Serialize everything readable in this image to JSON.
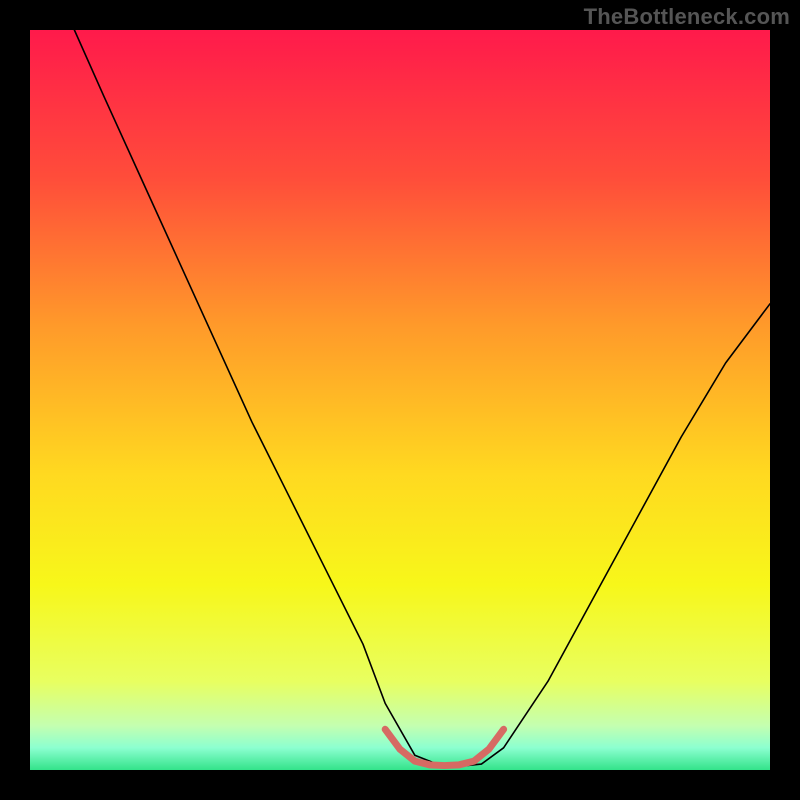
{
  "watermark": "TheBottleneck.com",
  "chart_data": {
    "type": "line",
    "title": "",
    "xlabel": "",
    "ylabel": "",
    "xlim": [
      0,
      100
    ],
    "ylim": [
      0,
      100
    ],
    "grid": false,
    "legend": false,
    "background_gradient": {
      "stops": [
        {
          "offset": 0.0,
          "color": "#ff1a4b"
        },
        {
          "offset": 0.2,
          "color": "#ff4d3a"
        },
        {
          "offset": 0.4,
          "color": "#ff9a2a"
        },
        {
          "offset": 0.6,
          "color": "#ffd920"
        },
        {
          "offset": 0.75,
          "color": "#f7f71a"
        },
        {
          "offset": 0.88,
          "color": "#e8ff60"
        },
        {
          "offset": 0.94,
          "color": "#c4ffb0"
        },
        {
          "offset": 0.97,
          "color": "#8cffd0"
        },
        {
          "offset": 1.0,
          "color": "#33e38a"
        }
      ]
    },
    "series": [
      {
        "name": "bottleneck-curve",
        "stroke": "#000000",
        "stroke_width": 1.6,
        "x": [
          6,
          10,
          15,
          20,
          25,
          30,
          35,
          40,
          45,
          48,
          52,
          55,
          58,
          61,
          64,
          70,
          76,
          82,
          88,
          94,
          100
        ],
        "y": [
          100,
          91,
          80,
          69,
          58,
          47,
          37,
          27,
          17,
          9,
          2,
          0.8,
          0.5,
          0.8,
          3,
          12,
          23,
          34,
          45,
          55,
          63
        ]
      },
      {
        "name": "optimal-band-marker",
        "stroke": "#d66a63",
        "stroke_width": 7,
        "x": [
          48,
          50,
          52,
          54,
          56,
          58,
          60,
          62,
          64
        ],
        "y": [
          5.5,
          2.8,
          1.2,
          0.7,
          0.6,
          0.7,
          1.2,
          2.8,
          5.5
        ]
      }
    ],
    "annotations": []
  }
}
